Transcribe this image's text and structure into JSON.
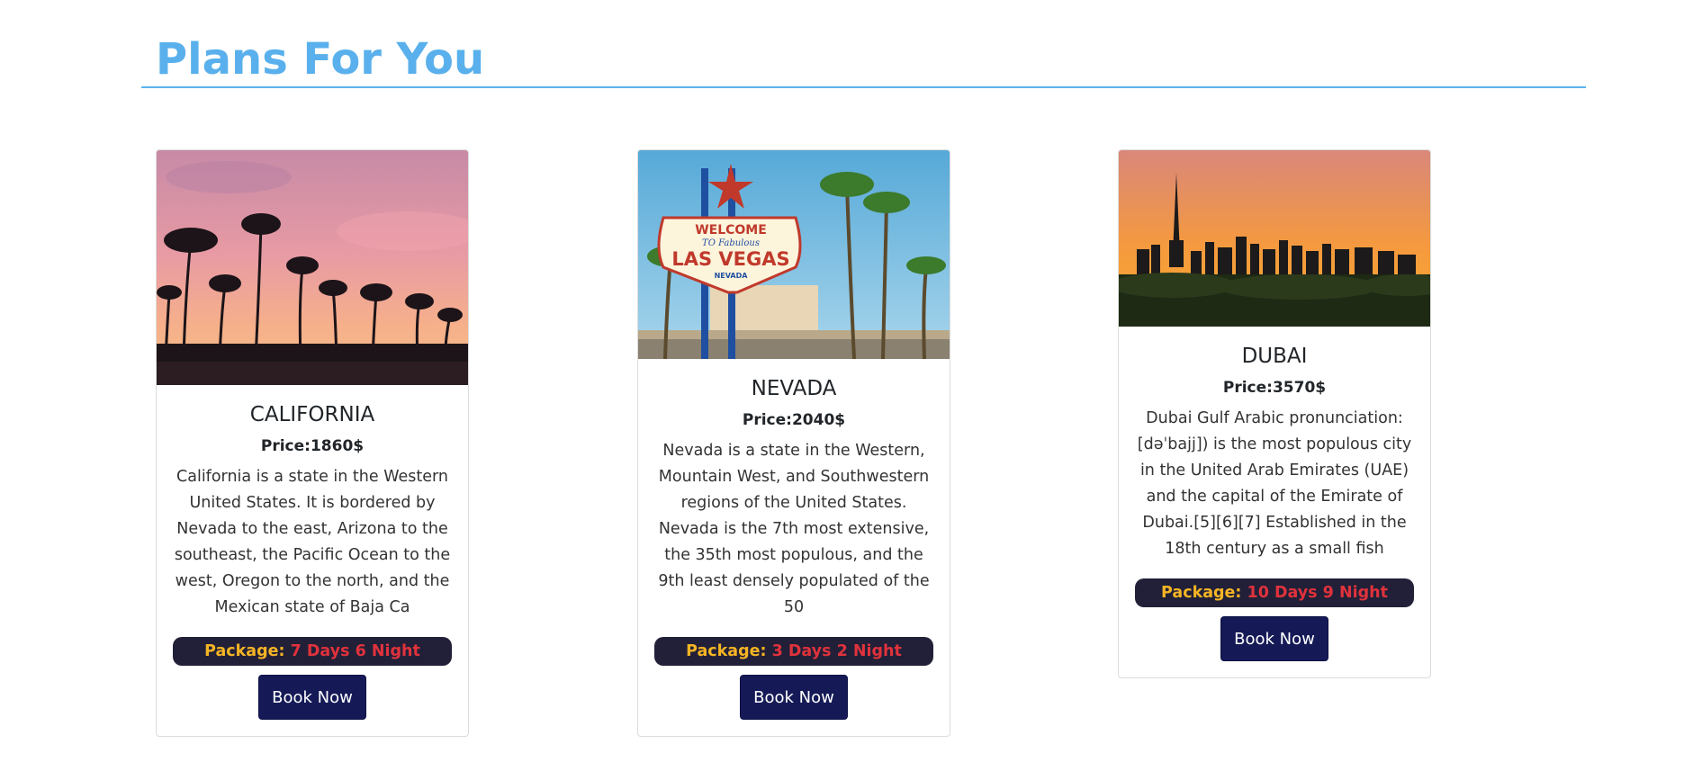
{
  "section": {
    "title": "Plans For You"
  },
  "cards": [
    {
      "title": "CALIFORNIA",
      "price": "Price:1860$",
      "description": "California is a state in the Western United States. It is bordered by Nevada to the east, Arizona to the southeast, the Pacific Ocean to the west, Oregon to the north, and the Mexican state of Baja Ca",
      "package_label": "Package:",
      "package_value": "7 Days 6 Night",
      "button_label": "Book Now"
    },
    {
      "title": "NEVADA",
      "price": "Price:2040$",
      "description": "Nevada is a state in the Western, Mountain West, and Southwestern regions of the United States. Nevada is the 7th most extensive, the 35th most populous, and the 9th least densely populated of the 50",
      "package_label": "Package:",
      "package_value": "3 Days 2 Night",
      "button_label": "Book Now",
      "sign": {
        "line1": "WELCOME",
        "line2": "TO Fabulous",
        "line3": "LAS VEGAS",
        "line4": "NEVADA"
      }
    },
    {
      "title": "DUBAI",
      "price": "Price:3570$",
      "description": "Dubai Gulf Arabic pronunciation: [dəˈbajj]) is the most populous city in the United Arab Emirates (UAE) and the capital of the Emirate of Dubai.[5][6][7] Established in the 18th century as a small fish",
      "package_label": "Package:",
      "package_value": "10 Days 9 Night",
      "button_label": "Book Now"
    }
  ],
  "colors": {
    "title_blue": "#59b0ec",
    "pill_bg": "#212038",
    "pill_label": "#f5b424",
    "pill_value": "#e0323c",
    "button_bg": "#151a57"
  }
}
